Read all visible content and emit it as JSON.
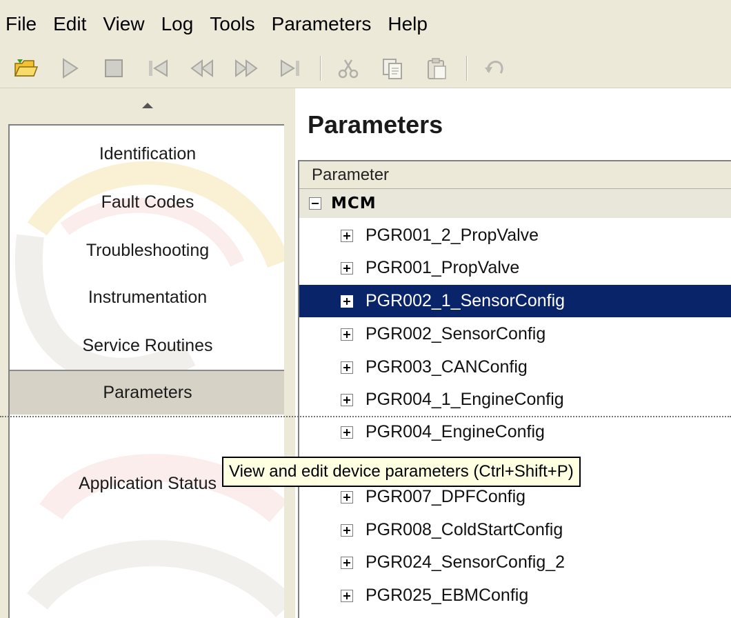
{
  "menu": {
    "items": [
      "File",
      "Edit",
      "View",
      "Log",
      "Tools",
      "Parameters",
      "Help"
    ]
  },
  "toolbar": {
    "buttons": [
      "open-icon",
      "play-icon",
      "stop-icon",
      "skip-start-icon",
      "rewind-icon",
      "fast-forward-icon",
      "skip-end-icon",
      "cut-icon",
      "copy-icon",
      "paste-icon",
      "undo-icon"
    ]
  },
  "sidebar": {
    "items": [
      {
        "label": "Identification"
      },
      {
        "label": "Fault Codes"
      },
      {
        "label": "Troubleshooting"
      },
      {
        "label": "Instrumentation"
      },
      {
        "label": "Service Routines"
      },
      {
        "label": "Parameters"
      },
      {
        "label": "Application Status"
      }
    ],
    "selected": "Parameters"
  },
  "main": {
    "title": "Parameters",
    "grid": {
      "column_header": "Parameter",
      "group": "MCM",
      "rows": [
        "PGR001_2_PropValve",
        "PGR001_PropValve",
        "PGR002_1_SensorConfig",
        "PGR002_SensorConfig",
        "PGR003_CANConfig",
        "PGR004_1_EngineConfig",
        "PGR004_EngineConfig",
        "",
        "PGR007_DPFConfig",
        "PGR008_ColdStartConfig",
        "PGR024_SensorConfig_2",
        "PGR025_EBMConfig"
      ],
      "selected_row": "PGR002_1_SensorConfig"
    }
  },
  "tooltip": {
    "text": "View and edit device parameters (Ctrl+Shift+P)"
  },
  "colors": {
    "chrome": "#ece9d8",
    "selection": "#0a246a",
    "tooltip_bg": "#ffffe1"
  }
}
